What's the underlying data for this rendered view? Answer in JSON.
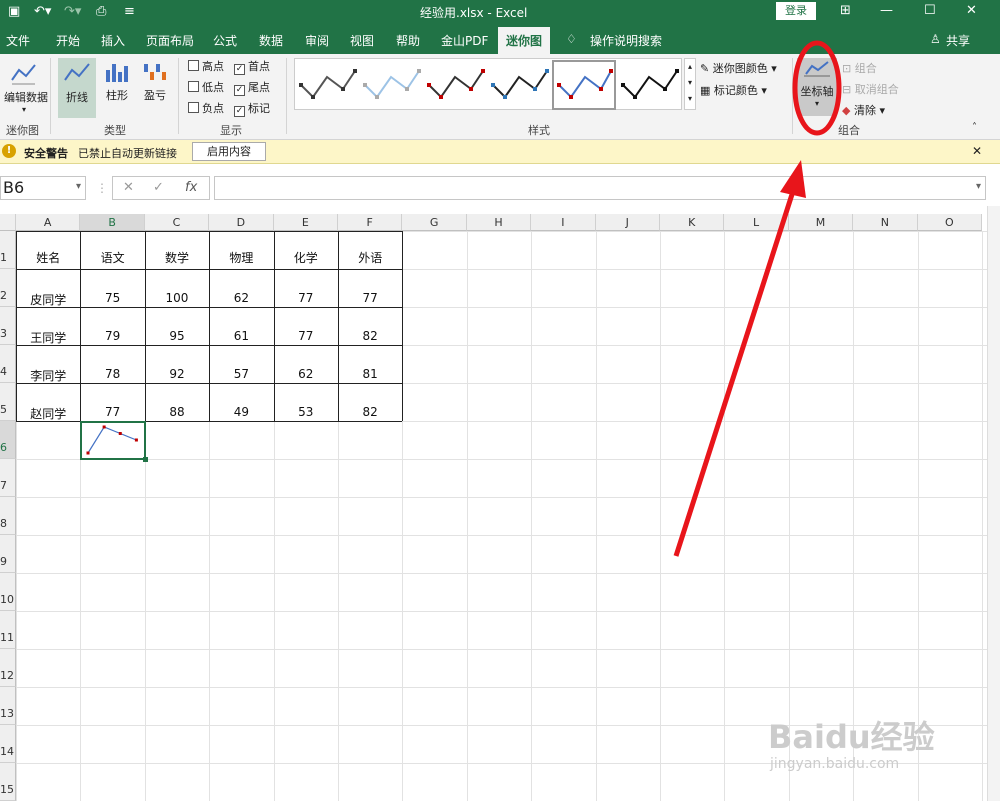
{
  "window": {
    "title": "经验用.xlsx - Excel",
    "login": "登录",
    "minimize": "—",
    "restore": "☐",
    "close": "✕"
  },
  "tabs": [
    {
      "label": "文件",
      "active": false
    },
    {
      "label": "开始",
      "active": false
    },
    {
      "label": "插入",
      "active": false
    },
    {
      "label": "页面布局",
      "active": false
    },
    {
      "label": "公式",
      "active": false
    },
    {
      "label": "数据",
      "active": false
    },
    {
      "label": "审阅",
      "active": false
    },
    {
      "label": "视图",
      "active": false
    },
    {
      "label": "帮助",
      "active": false
    },
    {
      "label": "金山PDF",
      "active": false
    },
    {
      "label": "迷你图",
      "active": true
    },
    {
      "label": "操作说明搜索",
      "active": false
    }
  ],
  "share": "共享",
  "ribbon": {
    "sparkline_group": {
      "edit_data": "编辑数据",
      "label": "迷你图"
    },
    "type_group": {
      "line": "折线",
      "column": "柱形",
      "winloss": "盈亏",
      "label": "类型"
    },
    "show_group": {
      "label": "显示",
      "options": [
        {
          "label": "高点",
          "checked": false
        },
        {
          "label": "首点",
          "checked": true
        },
        {
          "label": "低点",
          "checked": false
        },
        {
          "label": "尾点",
          "checked": true
        },
        {
          "label": "负点",
          "checked": false
        },
        {
          "label": "标记",
          "checked": true
        }
      ]
    },
    "style_group": {
      "label": "样式",
      "sparkline_color": "迷你图颜色",
      "marker_color": "标记颜色"
    },
    "axis_group": {
      "axis": "坐标轴",
      "group": "组合",
      "ungroup": "取消组合",
      "clear": "清除",
      "label": "组合"
    }
  },
  "security_bar": {
    "title": "安全警告",
    "message": "已禁止自动更新链接",
    "button": "启用内容"
  },
  "formula_bar": {
    "name_box": "B6",
    "cancel": "✕",
    "enter": "✓",
    "fx": "fx",
    "formula": ""
  },
  "sheet": {
    "columns": [
      "A",
      "B",
      "C",
      "D",
      "E",
      "F",
      "G",
      "H",
      "I",
      "J",
      "K",
      "L",
      "M",
      "N",
      "O"
    ],
    "rows": [
      "1",
      "2",
      "3",
      "4",
      "5",
      "6",
      "7",
      "8",
      "9",
      "10",
      "11",
      "12",
      "13",
      "14",
      "15"
    ],
    "data": [
      [
        "姓名",
        "语文",
        "数学",
        "物理",
        "化学",
        "外语"
      ],
      [
        "皮同学",
        "75",
        "100",
        "62",
        "77",
        "77"
      ],
      [
        "王同学",
        "79",
        "95",
        "61",
        "77",
        "82"
      ],
      [
        "李同学",
        "78",
        "92",
        "57",
        "62",
        "81"
      ],
      [
        "赵同学",
        "77",
        "88",
        "49",
        "53",
        "82"
      ]
    ],
    "sparkline": {
      "cell": "B6",
      "values": [
        75,
        79,
        78,
        77
      ],
      "color": "#4472c4",
      "marker_color": "#c00000"
    }
  },
  "colors": {
    "excel_green": "#217346",
    "annotation_red": "#e8151b"
  },
  "watermark": {
    "brand": "Baidu经验",
    "url": "jingyan.baidu.com"
  }
}
